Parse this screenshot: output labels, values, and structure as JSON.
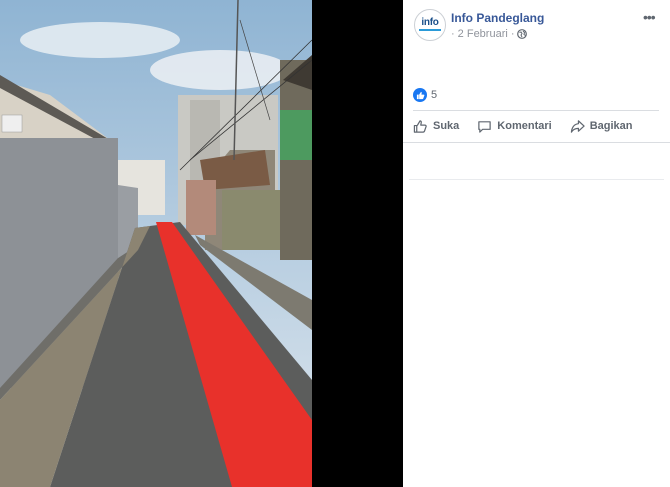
{
  "post": {
    "page_name": "Info Pandeglang",
    "date": "2 Februari",
    "separator": "·",
    "avatar_text": "info",
    "more_label": "•••"
  },
  "reactions": {
    "count": "5"
  },
  "actions": {
    "like": "Suka",
    "comment": "Komentari",
    "share": "Bagikan"
  },
  "icons": {
    "globe": "globe-icon",
    "more": "more-icon",
    "like": "thumbs-up-icon",
    "comment": "comment-bubble-icon",
    "share": "share-arrow-icon"
  },
  "colors": {
    "link": "#385898",
    "like_blue": "#1877f2",
    "red_carpet": "#e8312b"
  }
}
